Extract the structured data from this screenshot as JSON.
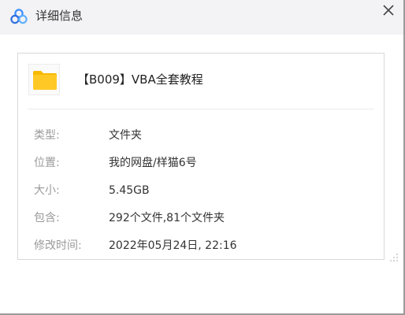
{
  "window": {
    "title": "详细信息",
    "app_icon": "baidu-netdisk-logo-icon",
    "close_icon": "close-icon",
    "accent_color": "#3b8cff"
  },
  "file": {
    "icon": "folder-icon",
    "icon_color": "#ffc825",
    "name": "【B009】VBA全套教程"
  },
  "details": [
    {
      "label": "类型:",
      "value": "文件夹"
    },
    {
      "label": "位置:",
      "value": "我的网盘/样猫6号"
    },
    {
      "label": "大小:",
      "value": "5.45GB"
    },
    {
      "label": "包含:",
      "value": "292个文件,81个文件夹"
    },
    {
      "label": "修改时间:",
      "value": "2022年05月24日, 22:16"
    }
  ]
}
